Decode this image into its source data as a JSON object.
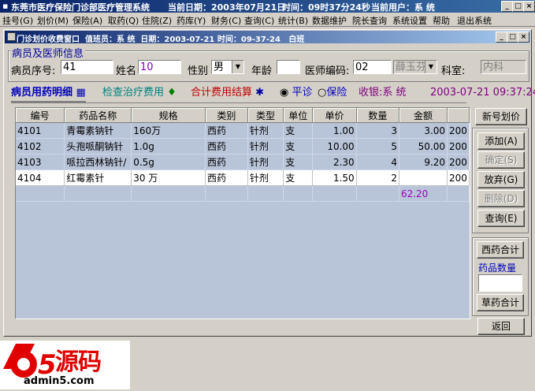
{
  "app": {
    "title": "东莞市医疗保险门诊部医疗管理系统",
    "date_label": "当前日期：2003年07月21日",
    "time_label": "时间：09时37分24秒",
    "user_label": "当前用户：系 统"
  },
  "menu": [
    "挂号(G)",
    "划价(M)",
    "保险(A)",
    "取药(Q)",
    "住院(Z)",
    "药库(Y)",
    "财务(C)",
    "查询(C)",
    "统计(B)",
    "数据维护",
    "院长查询",
    "系统设置",
    "帮助",
    "退出系统"
  ],
  "window": {
    "title": "门诊划价收费窗口",
    "operator": "值班员：系 统",
    "datetime": "日期：2003-07-21 时间：09-37-24",
    "shift": "白班"
  },
  "patient": {
    "group_label": "病员及医师信息",
    "seq_label": "病员序号",
    "seq_value": "41",
    "name_label": "姓名",
    "name_value": "10",
    "gender_label": "性别",
    "gender_value": "男",
    "age_label": "年龄",
    "age_value": "",
    "doctor_code_label": "医师编码",
    "doctor_code_value": "02",
    "doctor_name": "薛玉芬",
    "dept_label": "科室",
    "dept_value": "内科"
  },
  "tabs": {
    "drug_detail": "病员用药明细",
    "exam_fee": "检查治疗费用",
    "total_fee": "合计费用结算"
  },
  "visit": {
    "normal_label": "平诊",
    "insurance_label": "保险",
    "cashier": "收银:系 统",
    "datetime": "2003-07-21 09:37:24"
  },
  "grid": {
    "columns": [
      "编号",
      "药品名称",
      "规格",
      "类别",
      "类型",
      "单位",
      "单价",
      "数量",
      "金额",
      ""
    ],
    "rows": [
      [
        "4101",
        "青霉素钠针",
        "160万",
        "西药",
        "针剂",
        "支",
        "1.00",
        "3",
        "3.00",
        "200"
      ],
      [
        "4102",
        "头孢哌酮钠针",
        "1.0g",
        "西药",
        "针剂",
        "支",
        "10.00",
        "5",
        "50.00",
        "200"
      ],
      [
        "4103",
        "哌拉西林钠针/",
        "0.5g",
        "西药",
        "针剂",
        "支",
        "2.30",
        "4",
        "9.20",
        "200"
      ],
      [
        "4104",
        "红霉素针",
        "30 万",
        "西药",
        "针剂",
        "支",
        "1.50",
        "2",
        "",
        "200"
      ]
    ],
    "total": "62.20"
  },
  "buttons": {
    "new_price": "新号划价",
    "add": "添加(A)",
    "confirm": "确定(S)",
    "abandon": "放弃(G)",
    "delete": "删除(D)",
    "query": "查询(E)",
    "western_total": "西药合计",
    "drug_qty_label": "药品数量",
    "drug_qty_value": "",
    "herbal_total": "草药合计",
    "back": "返回"
  },
  "watermark": {
    "text": "源码",
    "site": "admin5.com"
  },
  "colors": {
    "title_bar": "#0a246a",
    "accent_text": "#0000c0",
    "readonly_text": "#808080",
    "grid_bg": "#b8c4d8",
    "total_text": "#a000c0",
    "logo_red": "#e00000"
  }
}
